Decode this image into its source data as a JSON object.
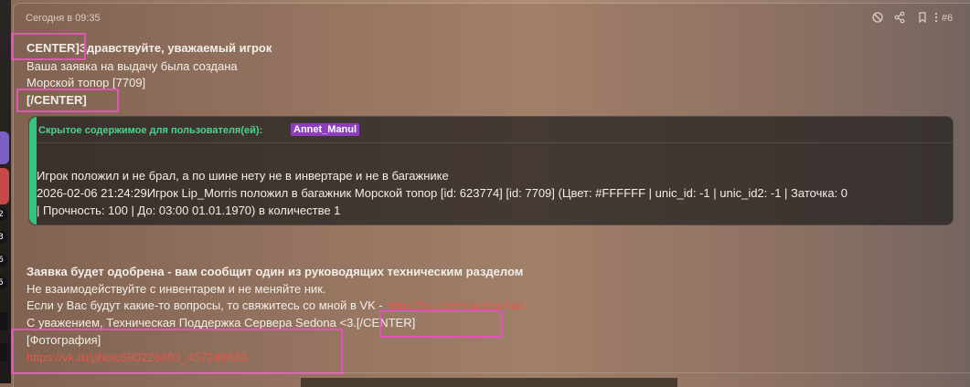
{
  "sidebar": {
    "badges": [
      "2",
      "3",
      "6",
      "5"
    ],
    "buttons": [
      {
        "color": "#7a5fc4"
      },
      {
        "color": "#c74a47"
      }
    ]
  },
  "post": {
    "date": "Сегодня в 09:35",
    "number": "#6",
    "icons": [
      "report-icon",
      "share-icon",
      "bookmark-icon",
      "more-icon"
    ],
    "lines": [
      "CENTER]Здравствуйте, уважаемый игрок",
      "Ваша заявка на выдачу была создана",
      "Морской топор [7709]",
      "[/CENTER]"
    ],
    "hidden": {
      "label": "Скрытое содержимое для пользователя(ей):",
      "user": "Annet_Manul",
      "line1": "Игрок положил и не брал, а по шине нету не в инвертаре и не в багажнике",
      "line2": "2026-02-06 21:24:29Игрок Lip_Morris положил в багажник Морской топор [id: 623774] [id: 7709] (Цвет: #FFFFFF | unic_id: -1 | unic_id2: -1 | Заточка: 0",
      "line3": "| Прочность: 100 | До: 03:00 01.01.1970) в количестве 1"
    },
    "footer": {
      "approval": "Заявка будет одобрена - вам сообщит один из руководящих техническим разделом",
      "warning": "Не взаимодействуйте с инвентарем и не меняйте ник.",
      "contact_prefix": "Если у Вас будут какие-то вопросы, то свяжитесь со мной в VK - ",
      "contact_link": "https://vk.com/kapybarkaa",
      "signature": "С уважением, Техническая Поддержка Сервера Sedona <3.[/CENTER]",
      "photo_label": "[Фотография]",
      "photo_link": "https://vk.ru/photo590226893_457249633"
    }
  },
  "colors": {
    "highlight": "#e254b8",
    "spoiler_accent": "#34c47e",
    "link": "#e15a4e",
    "user_badge": "#8c3ebe"
  }
}
